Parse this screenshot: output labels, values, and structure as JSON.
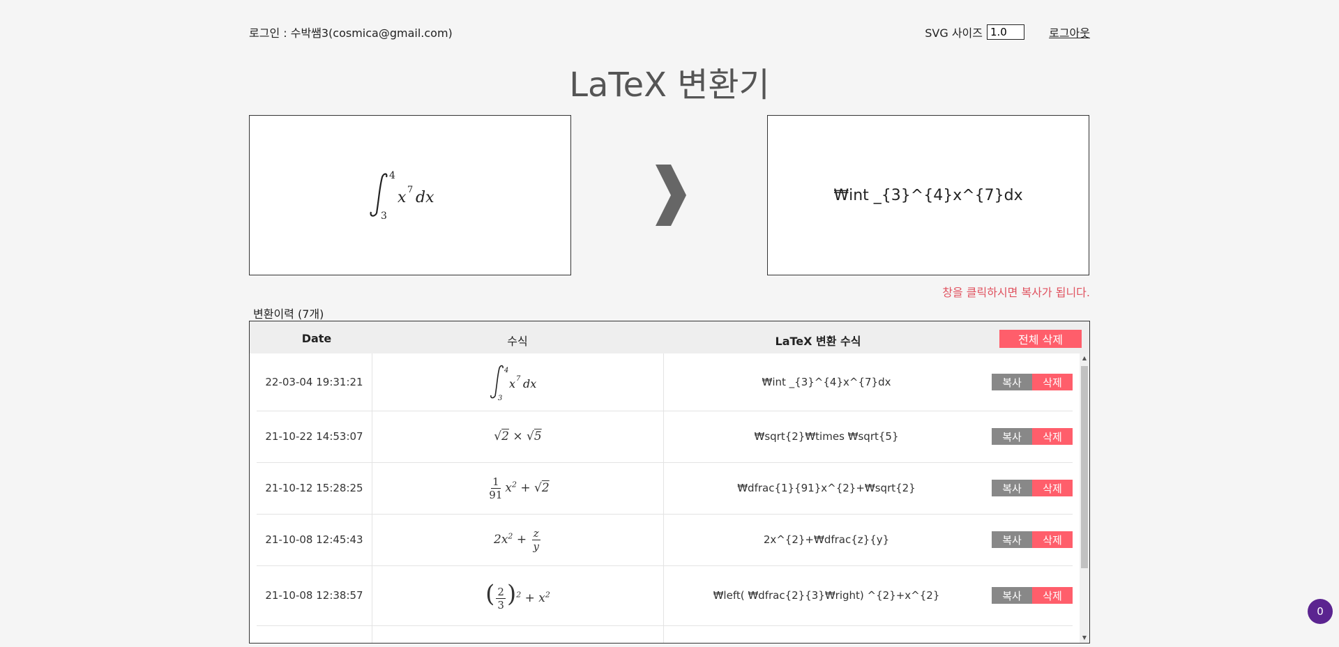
{
  "header": {
    "login_text": "로그인 : 수박쌤3(cosmica@gmail.com)",
    "svg_size_label": "SVG 사이즈",
    "svg_size_value": "1.0",
    "logout_label": "로그아웃"
  },
  "title": "LaTeX 변환기",
  "converter": {
    "input_formula": "∫₃⁴ x⁷ dx",
    "output_latex": "₩int _{3}^{4}x^{7}dx",
    "arrow_icon": "chevron-right-icon",
    "hint": "창을 클릭하시면 복사가 됩니다."
  },
  "history": {
    "label": "변환이력 (7개)",
    "columns": {
      "date": "Date",
      "formula": "수식",
      "latex": "LaTeX 변환 수식"
    },
    "delete_all_label": "전체 삭제",
    "copy_label": "복사",
    "delete_label": "삭제",
    "rows": [
      {
        "date": "22-03-04 19:31:21",
        "latex": "₩int _{3}^{4}x^{7}dx"
      },
      {
        "date": "21-10-22 14:53:07",
        "latex": "₩sqrt{2}₩times ₩sqrt{5}"
      },
      {
        "date": "21-10-12 15:28:25",
        "latex": "₩dfrac{1}{91}x^{2}+₩sqrt{2}"
      },
      {
        "date": "21-10-08 12:45:43",
        "latex": "2x^{2}+₩dfrac{z}{y}"
      },
      {
        "date": "21-10-08 12:38:57",
        "latex": "₩left( ₩dfrac{2}{3}₩right) ^{2}+x^{2}"
      }
    ]
  },
  "chat_badge": "0"
}
